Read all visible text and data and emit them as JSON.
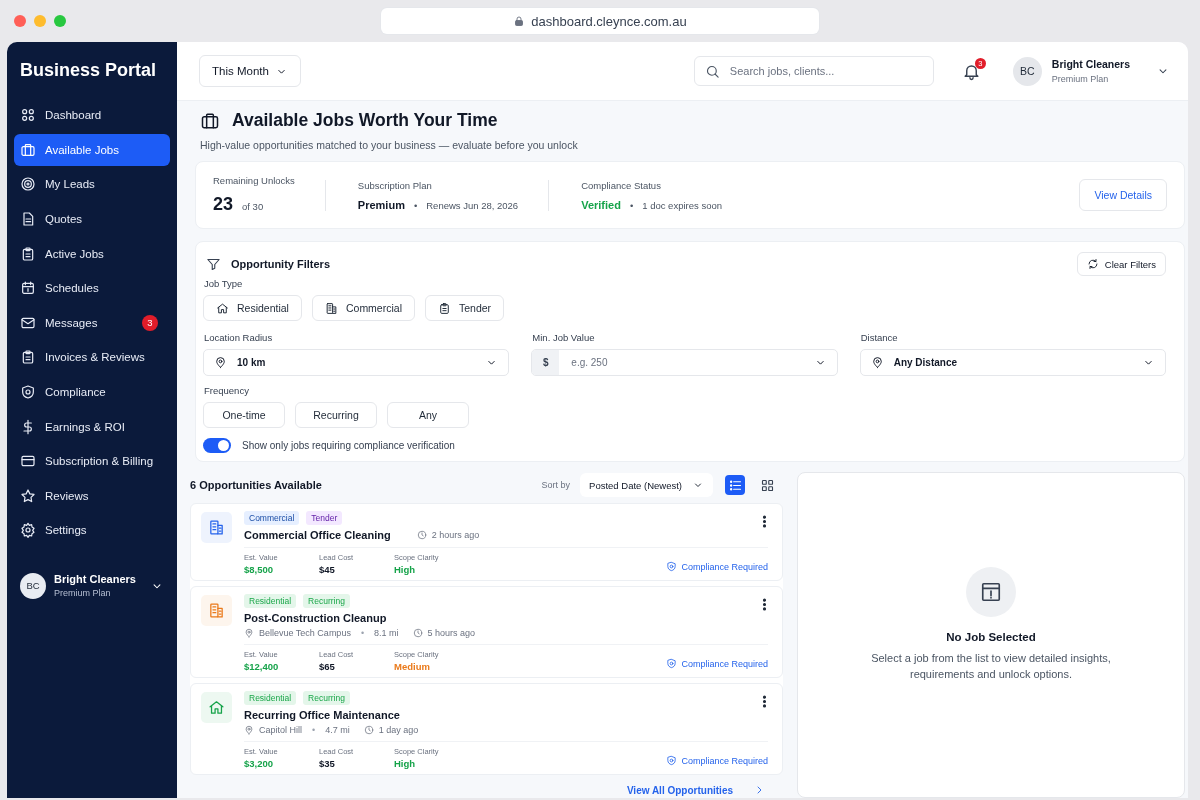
{
  "browser": {
    "url": "dashboard.cleynce.com.au"
  },
  "sidebar": {
    "title": "Business Portal",
    "items": [
      {
        "label": "Dashboard",
        "selected": false
      },
      {
        "label": "Available Jobs",
        "selected": true
      },
      {
        "label": "My Leads",
        "selected": false
      },
      {
        "label": "Quotes",
        "selected": false
      },
      {
        "label": "Active Jobs",
        "selected": false
      },
      {
        "label": "Schedules",
        "selected": false
      },
      {
        "label": "Messages",
        "selected": false,
        "badge": "3"
      },
      {
        "label": "Invoices & Reviews",
        "selected": false
      },
      {
        "label": "Compliance",
        "selected": false
      },
      {
        "label": "Earnings & ROI",
        "selected": false
      },
      {
        "label": "Subscription & Billing",
        "selected": false
      },
      {
        "label": "Reviews",
        "selected": false
      },
      {
        "label": "Settings",
        "selected": false
      }
    ],
    "user": {
      "initials": "BC",
      "name": "Bright Cleaners",
      "plan": "Premium Plan"
    }
  },
  "topbar": {
    "period": "This Month",
    "search": {
      "placeholder": "Search jobs, clients..."
    },
    "notifications": "3",
    "user": {
      "initials": "BC",
      "name": "Bright Cleaners",
      "plan": "Premium Plan"
    }
  },
  "header": {
    "title": "Available Jobs Worth Your Time",
    "subtitle": "High-value opportunities matched to your business — evaluate before you unlock"
  },
  "summary": {
    "unlocks": {
      "label": "Remaining Unlocks",
      "value": "23",
      "of": "of 30"
    },
    "plan": {
      "label": "Subscription Plan",
      "value": "Premium",
      "separator": "•",
      "note": "Renews Jun 28, 2026"
    },
    "compliance": {
      "label": "Compliance Status",
      "value": "Verified",
      "separator": "•",
      "note": "1 doc expires soon"
    },
    "button": "View Details"
  },
  "filters": {
    "title": "Opportunity Filters",
    "clear": "Clear Filters",
    "job_type": {
      "label": "Job Type",
      "options": [
        {
          "label": "Residential",
          "selected": false
        },
        {
          "label": "Commercial",
          "selected": false
        },
        {
          "label": "Tender",
          "selected": false
        }
      ]
    },
    "location_radius": {
      "label": "Location Radius",
      "value": "10 km"
    },
    "min_job_value": {
      "label": "Min. Job Value",
      "prefix": "$",
      "placeholder": "e.g. 250"
    },
    "distance": {
      "label": "Distance",
      "value": "Any Distance"
    },
    "frequency": {
      "label": "Frequency",
      "options": [
        {
          "label": "One-time",
          "selected": false
        },
        {
          "label": "Recurring",
          "selected": false
        },
        {
          "label": "Any",
          "selected": false
        }
      ]
    },
    "compliance_toggle": {
      "label": "Show only jobs requiring compliance verification",
      "on": true
    }
  },
  "list": {
    "count_title": "6 Opportunities Available",
    "sort_label": "Sort by",
    "sort_value": "Posted Date (Newest)",
    "views": [
      {
        "kind": "list",
        "selected": true
      },
      {
        "kind": "grid",
        "selected": false
      }
    ],
    "jobs": [
      {
        "kind": "commercial",
        "color": "#2563eb",
        "tags": [
          {
            "label": "Commercial",
            "color": "#e6efff"
          },
          {
            "label": "Tender",
            "color": "#f3e8ff"
          }
        ],
        "title": "Commercial Office Cleaning",
        "posted": "2 hours ago",
        "stats": [
          {
            "label": "Est. Value",
            "value": "$8,500",
            "color": "#16a34a"
          },
          {
            "label": "Lead Cost",
            "value": "$45",
            "color": "#111827"
          },
          {
            "label": "Scope Clarity",
            "value": "High",
            "color": "#16a34a"
          }
        ],
        "compliance": "Compliance Required"
      },
      {
        "kind": "commercial",
        "color": "#ea7a1b",
        "tags": [
          {
            "label": "Residential",
            "color": "#e4f6ea"
          },
          {
            "label": "Recurring",
            "color": "#e4f6ea"
          }
        ],
        "title": "Post-Construction Cleanup",
        "location": "Bellevue Tech Campus",
        "separator": "•",
        "distance": "8.1 mi",
        "posted": "5 hours ago",
        "stats": [
          {
            "label": "Est. Value",
            "value": "$12,400",
            "color": "#16a34a"
          },
          {
            "label": "Lead Cost",
            "value": "$65",
            "color": "#111827"
          },
          {
            "label": "Scope Clarity",
            "value": "Medium",
            "color": "#ea7a1b"
          }
        ],
        "compliance": "Compliance Required"
      },
      {
        "kind": "residential",
        "color": "#16a34a",
        "tags": [
          {
            "label": "Residential",
            "color": "#e4f6ea"
          },
          {
            "label": "Recurring",
            "color": "#e4f6ea"
          }
        ],
        "title": "Recurring Office Maintenance",
        "location": "Capitol Hill",
        "separator": "•",
        "distance": "4.7 mi",
        "posted": "1 day ago",
        "stats": [
          {
            "label": "Est. Value",
            "value": "$3,200",
            "color": "#16a34a"
          },
          {
            "label": "Lead Cost",
            "value": "$35",
            "color": "#111827"
          },
          {
            "label": "Scope Clarity",
            "value": "High",
            "color": "#16a34a"
          }
        ],
        "compliance": "Compliance Required"
      }
    ],
    "view_all": "View All Opportunities"
  },
  "detail": {
    "title": "No Job Selected",
    "text": "Select a job from the list to view detailed insights, requirements and unlock options."
  }
}
